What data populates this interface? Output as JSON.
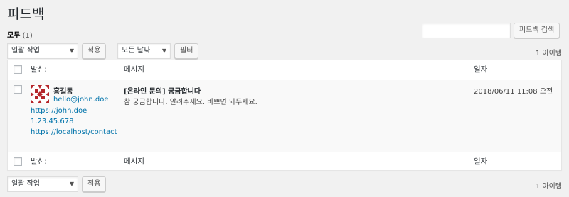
{
  "page": {
    "title": "피드백"
  },
  "filter_links": {
    "all_label": "모두",
    "all_count": "(1)"
  },
  "search": {
    "input_value": "",
    "button_label": "피드백 검색"
  },
  "top_nav": {
    "bulk_action_value": "일괄 작업",
    "apply_label": "적용",
    "date_value": "모든 날짜",
    "filter_label": "필터",
    "item_count": "1 아이템"
  },
  "table": {
    "columns": {
      "from": "발신:",
      "message": "메시지",
      "date": "일자"
    },
    "rows": [
      {
        "author_name": "홍길동",
        "email": "hello@john.doe",
        "url": "https://john.doe",
        "ip": "1.23.45.678",
        "contact_page": "https://localhost/contact",
        "subject": "[온라인 문의] 궁금합니다",
        "body": "참 궁금합니다. 알려주세요. 바쁘면 놔두세요.",
        "date": "2018/06/11 11:08 오전"
      }
    ]
  },
  "bottom_nav": {
    "bulk_action_value": "일괄 작업",
    "apply_label": "적용",
    "item_count": "1 아이템"
  },
  "icons": {
    "avatar": "identicon-avatar",
    "dropdown": "chevron-down-icon"
  },
  "colors": {
    "link": "#0073aa",
    "avatar": "#b5262b"
  }
}
